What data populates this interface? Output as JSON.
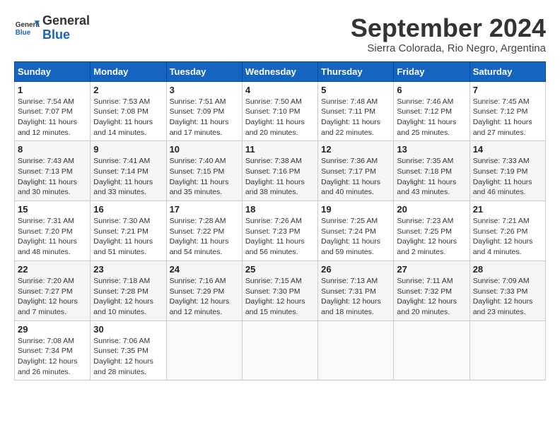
{
  "header": {
    "logo_general": "General",
    "logo_blue": "Blue",
    "month_title": "September 2024",
    "subtitle": "Sierra Colorada, Rio Negro, Argentina"
  },
  "weekdays": [
    "Sunday",
    "Monday",
    "Tuesday",
    "Wednesday",
    "Thursday",
    "Friday",
    "Saturday"
  ],
  "weeks": [
    [
      {
        "day": "1",
        "info": "Sunrise: 7:54 AM\nSunset: 7:07 PM\nDaylight: 11 hours\nand 12 minutes."
      },
      {
        "day": "2",
        "info": "Sunrise: 7:53 AM\nSunset: 7:08 PM\nDaylight: 11 hours\nand 14 minutes."
      },
      {
        "day": "3",
        "info": "Sunrise: 7:51 AM\nSunset: 7:09 PM\nDaylight: 11 hours\nand 17 minutes."
      },
      {
        "day": "4",
        "info": "Sunrise: 7:50 AM\nSunset: 7:10 PM\nDaylight: 11 hours\nand 20 minutes."
      },
      {
        "day": "5",
        "info": "Sunrise: 7:48 AM\nSunset: 7:11 PM\nDaylight: 11 hours\nand 22 minutes."
      },
      {
        "day": "6",
        "info": "Sunrise: 7:46 AM\nSunset: 7:12 PM\nDaylight: 11 hours\nand 25 minutes."
      },
      {
        "day": "7",
        "info": "Sunrise: 7:45 AM\nSunset: 7:12 PM\nDaylight: 11 hours\nand 27 minutes."
      }
    ],
    [
      {
        "day": "8",
        "info": "Sunrise: 7:43 AM\nSunset: 7:13 PM\nDaylight: 11 hours\nand 30 minutes."
      },
      {
        "day": "9",
        "info": "Sunrise: 7:41 AM\nSunset: 7:14 PM\nDaylight: 11 hours\nand 33 minutes."
      },
      {
        "day": "10",
        "info": "Sunrise: 7:40 AM\nSunset: 7:15 PM\nDaylight: 11 hours\nand 35 minutes."
      },
      {
        "day": "11",
        "info": "Sunrise: 7:38 AM\nSunset: 7:16 PM\nDaylight: 11 hours\nand 38 minutes."
      },
      {
        "day": "12",
        "info": "Sunrise: 7:36 AM\nSunset: 7:17 PM\nDaylight: 11 hours\nand 40 minutes."
      },
      {
        "day": "13",
        "info": "Sunrise: 7:35 AM\nSunset: 7:18 PM\nDaylight: 11 hours\nand 43 minutes."
      },
      {
        "day": "14",
        "info": "Sunrise: 7:33 AM\nSunset: 7:19 PM\nDaylight: 11 hours\nand 46 minutes."
      }
    ],
    [
      {
        "day": "15",
        "info": "Sunrise: 7:31 AM\nSunset: 7:20 PM\nDaylight: 11 hours\nand 48 minutes."
      },
      {
        "day": "16",
        "info": "Sunrise: 7:30 AM\nSunset: 7:21 PM\nDaylight: 11 hours\nand 51 minutes."
      },
      {
        "day": "17",
        "info": "Sunrise: 7:28 AM\nSunset: 7:22 PM\nDaylight: 11 hours\nand 54 minutes."
      },
      {
        "day": "18",
        "info": "Sunrise: 7:26 AM\nSunset: 7:23 PM\nDaylight: 11 hours\nand 56 minutes."
      },
      {
        "day": "19",
        "info": "Sunrise: 7:25 AM\nSunset: 7:24 PM\nDaylight: 11 hours\nand 59 minutes."
      },
      {
        "day": "20",
        "info": "Sunrise: 7:23 AM\nSunset: 7:25 PM\nDaylight: 12 hours\nand 2 minutes."
      },
      {
        "day": "21",
        "info": "Sunrise: 7:21 AM\nSunset: 7:26 PM\nDaylight: 12 hours\nand 4 minutes."
      }
    ],
    [
      {
        "day": "22",
        "info": "Sunrise: 7:20 AM\nSunset: 7:27 PM\nDaylight: 12 hours\nand 7 minutes."
      },
      {
        "day": "23",
        "info": "Sunrise: 7:18 AM\nSunset: 7:28 PM\nDaylight: 12 hours\nand 10 minutes."
      },
      {
        "day": "24",
        "info": "Sunrise: 7:16 AM\nSunset: 7:29 PM\nDaylight: 12 hours\nand 12 minutes."
      },
      {
        "day": "25",
        "info": "Sunrise: 7:15 AM\nSunset: 7:30 PM\nDaylight: 12 hours\nand 15 minutes."
      },
      {
        "day": "26",
        "info": "Sunrise: 7:13 AM\nSunset: 7:31 PM\nDaylight: 12 hours\nand 18 minutes."
      },
      {
        "day": "27",
        "info": "Sunrise: 7:11 AM\nSunset: 7:32 PM\nDaylight: 12 hours\nand 20 minutes."
      },
      {
        "day": "28",
        "info": "Sunrise: 7:09 AM\nSunset: 7:33 PM\nDaylight: 12 hours\nand 23 minutes."
      }
    ],
    [
      {
        "day": "29",
        "info": "Sunrise: 7:08 AM\nSunset: 7:34 PM\nDaylight: 12 hours\nand 26 minutes."
      },
      {
        "day": "30",
        "info": "Sunrise: 7:06 AM\nSunset: 7:35 PM\nDaylight: 12 hours\nand 28 minutes."
      },
      {
        "day": "",
        "info": ""
      },
      {
        "day": "",
        "info": ""
      },
      {
        "day": "",
        "info": ""
      },
      {
        "day": "",
        "info": ""
      },
      {
        "day": "",
        "info": ""
      }
    ]
  ]
}
